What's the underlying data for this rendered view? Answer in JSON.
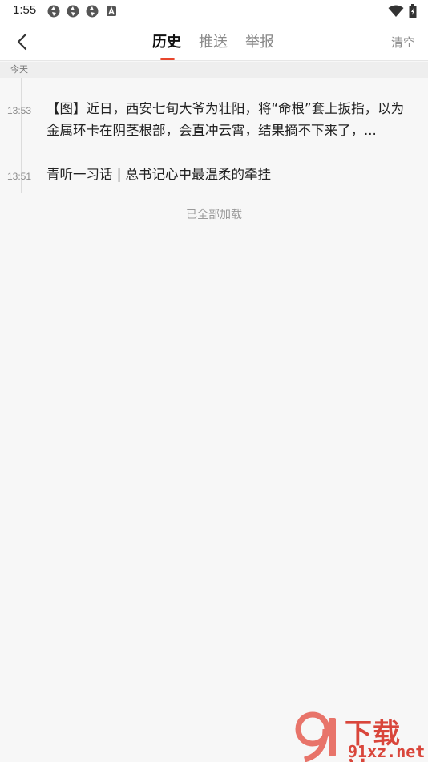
{
  "status_bar": {
    "time": "1:55",
    "left_icons": [
      "notification-icon",
      "notification-icon",
      "notification-icon",
      "keyboard-a-icon"
    ],
    "right_icons": [
      "wifi-icon",
      "battery-icon"
    ]
  },
  "nav": {
    "tabs": [
      {
        "label": "历史",
        "active": true
      },
      {
        "label": "推送",
        "active": false
      },
      {
        "label": "举报",
        "active": false
      }
    ],
    "clear_label": "清空",
    "accent_color": "#e8452c"
  },
  "history": {
    "date_label": "今天",
    "items": [
      {
        "time": "13:53",
        "title": "【图】近日，西安七旬大爷为壮阳，将“命根”套上扳指，以为金属环卡在阴茎根部，会直冲云霄，结果摘不下来了，..."
      },
      {
        "time": "13:51",
        "title": "青听一习话 | 总书记心中最温柔的牵挂"
      }
    ],
    "end_label": "已全部加载"
  },
  "watermark": {
    "text_main": "下载站",
    "text_url": "91xz.net"
  }
}
